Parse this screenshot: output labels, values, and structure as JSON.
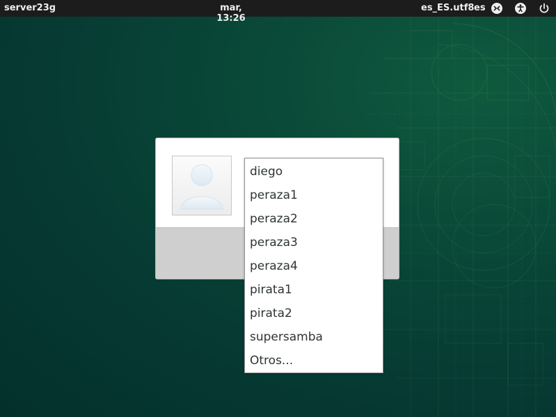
{
  "topbar": {
    "hostname": "server23g",
    "clock": "mar, 13:26",
    "locale": "es_ES.utf8",
    "keyboard": "es",
    "icons": [
      "xfce-session-icon",
      "accessibility-icon",
      "power-icon"
    ]
  },
  "login": {
    "avatar_icon": "user-avatar-icon",
    "users": [
      {
        "label": "diego"
      },
      {
        "label": "peraza1"
      },
      {
        "label": "peraza2"
      },
      {
        "label": "peraza3"
      },
      {
        "label": "peraza4"
      },
      {
        "label": "pirata1"
      },
      {
        "label": "pirata2"
      },
      {
        "label": "supersamba"
      },
      {
        "label": "Otros..."
      }
    ]
  },
  "colors": {
    "background": "#063a33",
    "topbar": "#1c1c1c",
    "blueprint_lines": "#6fa862"
  }
}
